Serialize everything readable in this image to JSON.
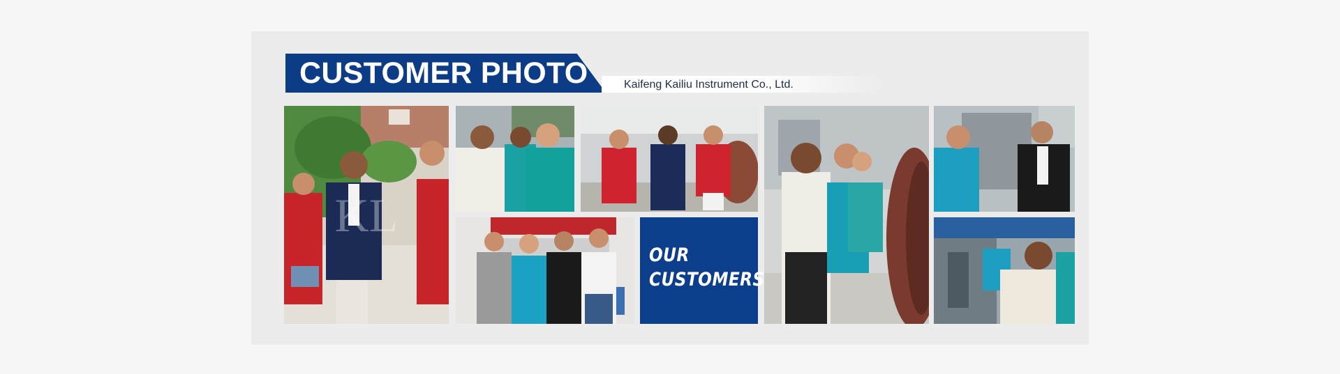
{
  "header": {
    "title": "CUSTOMER PHOTO",
    "subtitle": "Kaifeng Kailiu Instrument Co., Ltd."
  },
  "banner": {
    "line1": "OUR",
    "line2": "CUSTOMERS"
  },
  "colors": {
    "brand_blue": "#0c3c86",
    "page_background": "#f7f7f7",
    "panel_background": "#ececec"
  }
}
